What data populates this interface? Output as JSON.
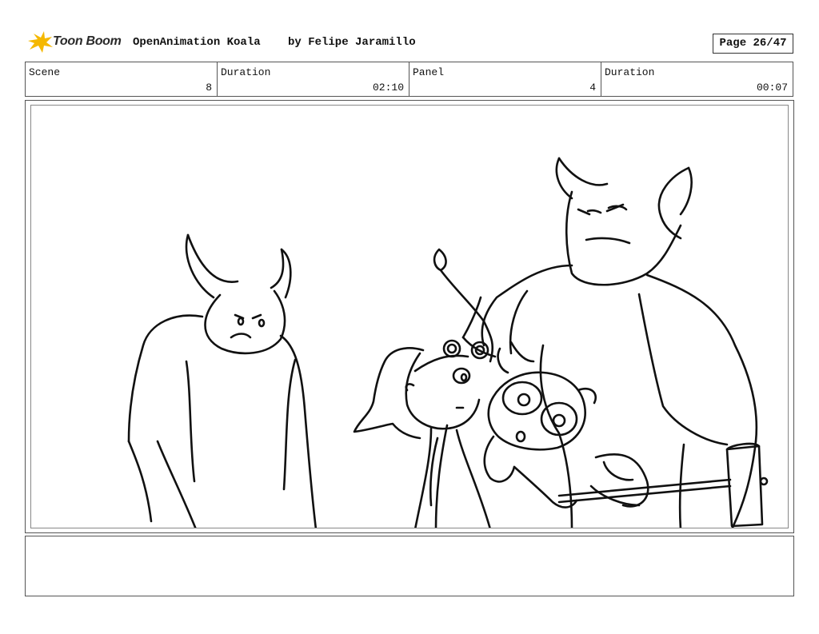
{
  "header": {
    "logo_text": "Toon Boom",
    "project_title": "OpenAnimation Koala",
    "project_author": "by Felipe Jaramillo",
    "page_label": "Page 26/47"
  },
  "info": {
    "scene_label": "Scene",
    "scene_value": "8",
    "scene_duration_label": "Duration",
    "scene_duration_value": "02:10",
    "panel_label": "Panel",
    "panel_value": "4",
    "panel_duration_label": "Duration",
    "panel_duration_value": "00:07"
  },
  "colors": {
    "logo_accent": "#f5b800",
    "line": "#111111"
  },
  "notes": {
    "text": ""
  }
}
